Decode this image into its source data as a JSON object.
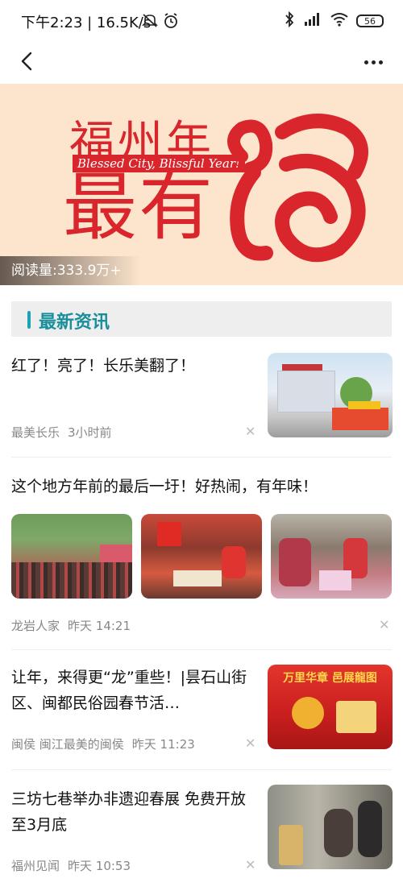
{
  "status": {
    "time": "下午2:23 | 16.5K/s",
    "battery": "56"
  },
  "banner": {
    "title_line1": "福州年",
    "title_en": "Blessed City, Blissful Year!",
    "title_line2": "最有",
    "read_count": "阅读量:333.9万+"
  },
  "section": {
    "title": "最新资讯"
  },
  "articles": [
    {
      "title": "红了！亮了！长乐美翻了！",
      "source": "最美长乐",
      "time": "3小时前"
    },
    {
      "title": "这个地方年前的最后一圩！好热闹，有年味！",
      "source": "龙岩人家",
      "time": "昨天 14:21"
    },
    {
      "title": "让年，来得更“龙”重些！|昙石山街区、闽都民俗园春节活…",
      "source": "闽侯 闽江最美的闽侯",
      "time": "昨天 11:23"
    },
    {
      "title": "三坊七巷举办非遗迎春展 免费开放至3月底",
      "source": "福州见闻",
      "time": "昨天 10:53"
    }
  ],
  "thumb3": {
    "banner_text": "万里华章 邑展龍图"
  },
  "colors": {
    "accent": "#1a8f9c",
    "brand_red": "#d9262c",
    "banner_bg": "#fde5cd"
  }
}
